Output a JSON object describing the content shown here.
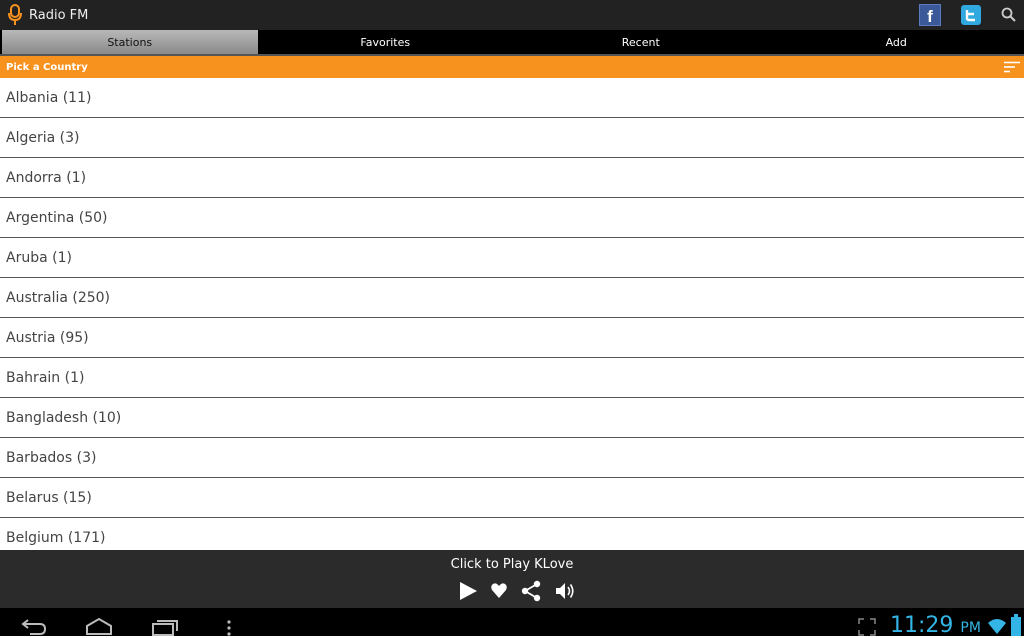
{
  "app": {
    "title": "Radio FM"
  },
  "tabs": [
    "Stations",
    "Favorites",
    "Recent",
    "Add"
  ],
  "header": {
    "label": "Pick a Country"
  },
  "countries": [
    "Albania (11)",
    "Algeria (3)",
    "Andorra (1)",
    "Argentina (50)",
    "Aruba (1)",
    "Australia (250)",
    "Austria (95)",
    "Bahrain (1)",
    "Bangladesh (10)",
    "Barbados (3)",
    "Belarus (15)",
    "Belgium (171)"
  ],
  "player": {
    "now_playing": "Click to Play KLove"
  },
  "status": {
    "time": "11:29",
    "ampm": "PM"
  },
  "colors": {
    "accent": "#f7921e",
    "clock": "#33b5e5"
  }
}
